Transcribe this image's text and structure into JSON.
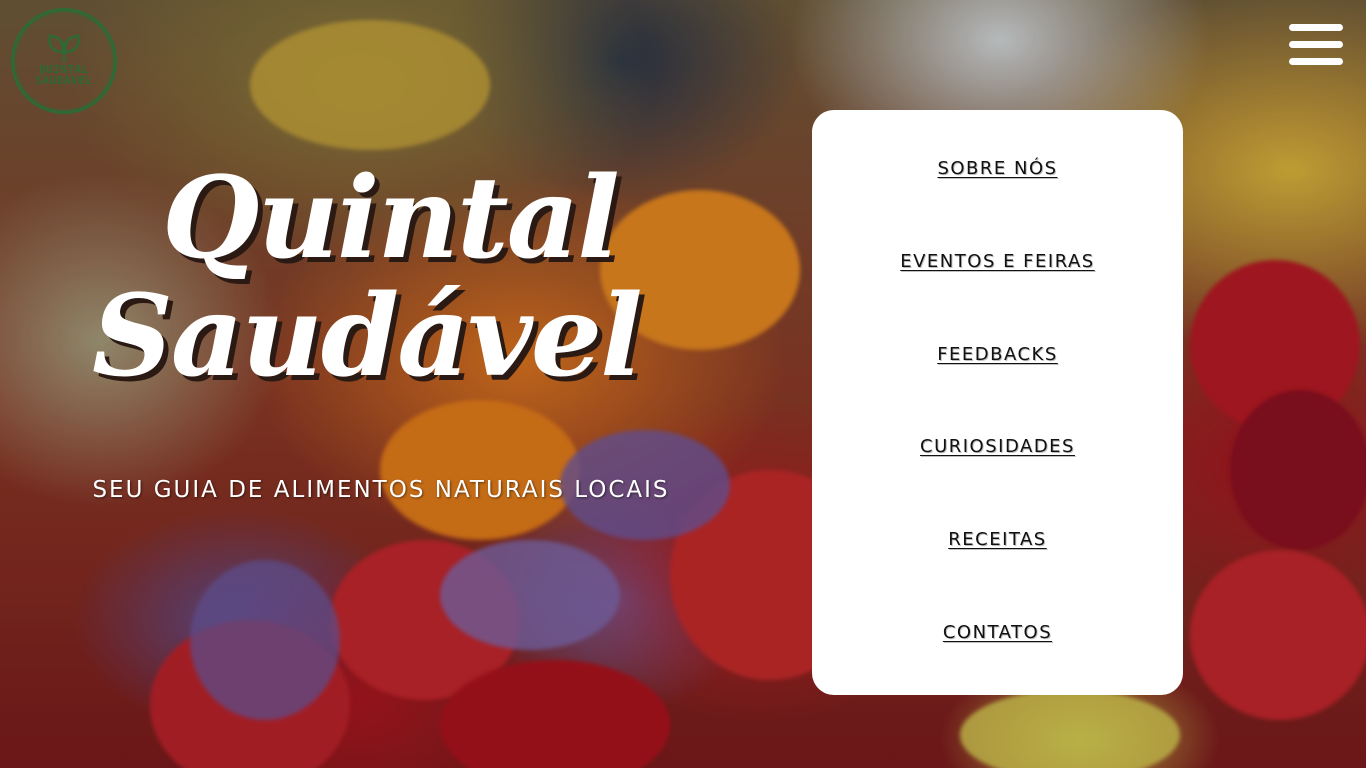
{
  "brand": {
    "logo_lines": [
      "QUINTAL",
      "SAUDÁVEL"
    ],
    "logo_color": "#2d6a36"
  },
  "header": {
    "menu_icon": "hamburger-menu-icon"
  },
  "hero": {
    "title_line1": "Quintal",
    "title_line2": "Saudável",
    "tagline": "SEU GUIA DE ALIMENTOS NATURAIS LOCAIS"
  },
  "nav": {
    "items": [
      {
        "label": "SOBRE NÓS"
      },
      {
        "label": "EVENTOS E FEIRAS"
      },
      {
        "label": "FEEDBACKS"
      },
      {
        "label": "CURIOSIDADES"
      },
      {
        "label": "RECEITAS"
      },
      {
        "label": "CONTATOS"
      }
    ]
  },
  "colors": {
    "panel_bg": "#ffffff",
    "text_dark": "#111111",
    "text_light": "#ffffff"
  }
}
